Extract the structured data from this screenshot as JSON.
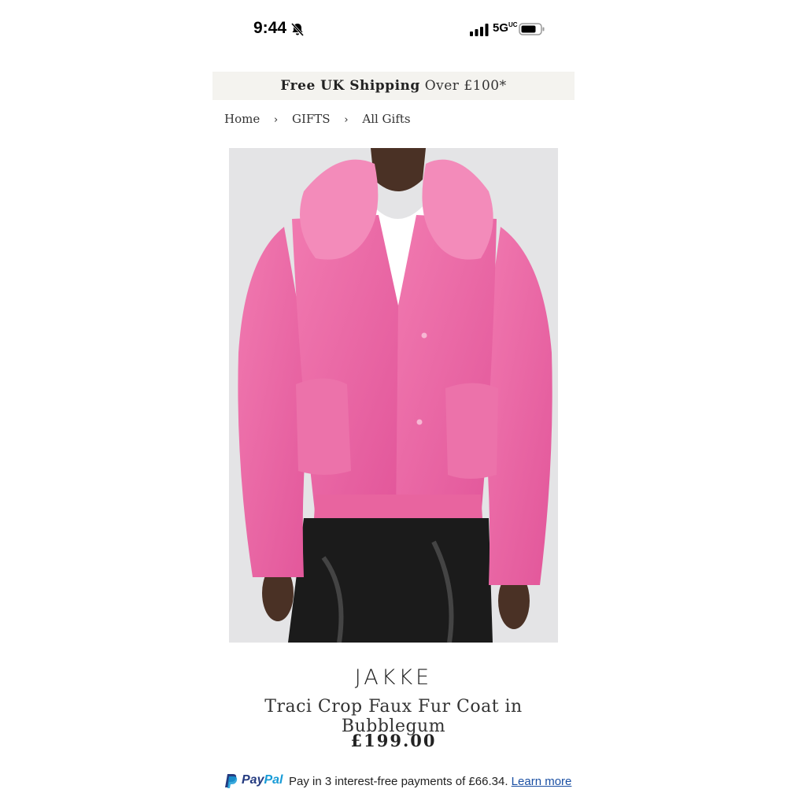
{
  "status_bar": {
    "time": "9:44",
    "network": "5G",
    "network_suffix": "UC"
  },
  "banner": {
    "bold": "Free UK Shipping",
    "rest": "Over £100*"
  },
  "breadcrumb": {
    "items": [
      "Home",
      "GIFTS",
      "All Gifts"
    ],
    "separator": "›"
  },
  "product": {
    "brand": "JAKKE",
    "name": "Traci Crop Faux Fur Coat in Bubblegum",
    "price": "£199.00",
    "image_icon": "product-photo"
  },
  "paypal": {
    "logo_p": "Pay",
    "logo_pal": "Pal",
    "message": "Pay in 3 interest-free payments of £66.34.",
    "link": "Learn more"
  },
  "colors": {
    "accent_pink": "#e8609a",
    "banner_bg": "#f4f3ef",
    "paypal_blue": "#253b80",
    "paypal_light": "#179bd7"
  }
}
